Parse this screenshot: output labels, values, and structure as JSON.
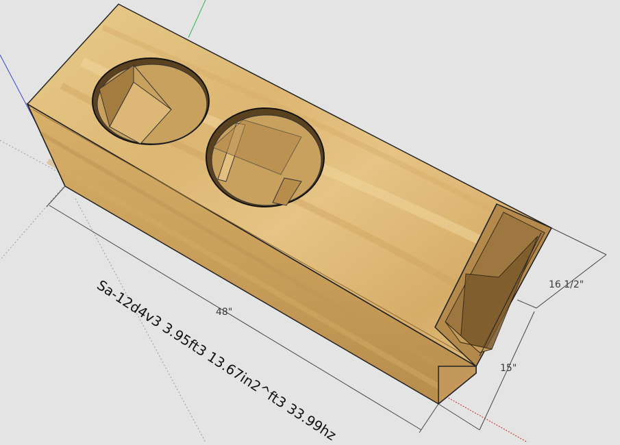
{
  "model": {
    "caption": "Sa-12d4v3 3.95ft3 13.67in2^ft3 33.99hz",
    "wood_colors": {
      "light": "#e8c98a",
      "mid": "#d9b06a",
      "dark": "#b98d4c",
      "side": "#c79a58",
      "edge": "#a97c3e"
    }
  },
  "dimensions": {
    "length": "48\"",
    "height": "16 1/2\"",
    "depth": "15\""
  },
  "axes": {
    "green": "#2fb84a",
    "red": "#c62020",
    "blue": "#3a44c8"
  }
}
